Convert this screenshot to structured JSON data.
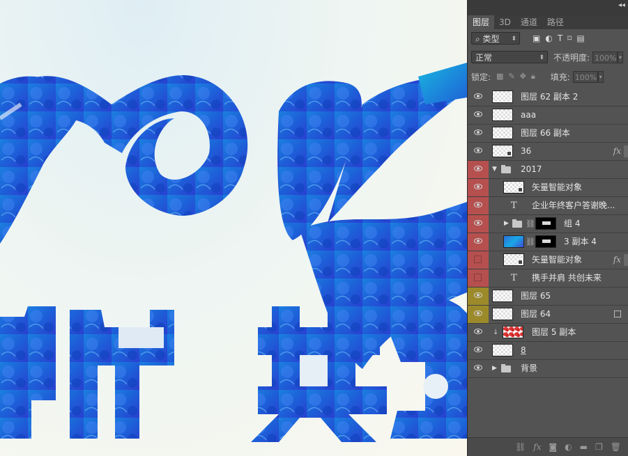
{
  "canvas": {
    "artwork_text": "携手并肩 共创未来"
  },
  "panel": {
    "tabs": [
      "图层",
      "3D",
      "通道",
      "路径"
    ],
    "filter": {
      "kind_label": "类型",
      "search_icon": "search-icon"
    },
    "blend_mode": "正常",
    "opacity_label": "不透明度:",
    "opacity_value": "100%",
    "lock_label": "锁定:",
    "fill_label": "填充:",
    "fill_value": "100%",
    "layers": [
      {
        "name": "图层 62 副本 2",
        "visible": true,
        "color": "none",
        "kind": "pixel"
      },
      {
        "name": "aaa",
        "visible": true,
        "color": "none",
        "kind": "pixel"
      },
      {
        "name": "图层 66 副本",
        "visible": true,
        "color": "none",
        "kind": "pixel"
      },
      {
        "name": "36",
        "visible": true,
        "color": "none",
        "kind": "smart",
        "fx": "fx"
      },
      {
        "name": "2017",
        "visible": true,
        "color": "red",
        "kind": "group-open"
      },
      {
        "name": "矢量智能对象",
        "visible": true,
        "color": "red",
        "kind": "smart"
      },
      {
        "name": "企业年终客户答谢晚...",
        "visible": true,
        "color": "red",
        "kind": "text"
      },
      {
        "name": "组 4",
        "visible": true,
        "color": "red",
        "kind": "group-mask"
      },
      {
        "name": "3 副本 4",
        "visible": true,
        "color": "red",
        "kind": "pixel-mask"
      },
      {
        "name": "矢量智能对象",
        "visible": false,
        "color": "red",
        "kind": "smart",
        "fx": "fx"
      },
      {
        "name": "携手并肩 共创未来",
        "visible": false,
        "color": "red",
        "kind": "text"
      },
      {
        "name": "图层 65",
        "visible": true,
        "color": "yellow",
        "kind": "pixel"
      },
      {
        "name": "图层 64",
        "visible": true,
        "color": "yellow",
        "kind": "pixel"
      },
      {
        "name": "图层 5 副本",
        "visible": true,
        "color": "none",
        "kind": "clipped"
      },
      {
        "name": "8",
        "visible": true,
        "color": "none",
        "kind": "pixel"
      },
      {
        "name": "背景",
        "visible": true,
        "color": "none",
        "kind": "group-closed"
      }
    ],
    "bottom_icons": [
      "link-icon",
      "fx-icon",
      "mask-icon",
      "adjustment-icon",
      "folder-icon",
      "new-layer-icon",
      "trash-icon"
    ],
    "colors": {
      "panel_bg": "#535353",
      "red_tag": "#b5504f",
      "yellow_tag": "#9c8a2a"
    }
  }
}
